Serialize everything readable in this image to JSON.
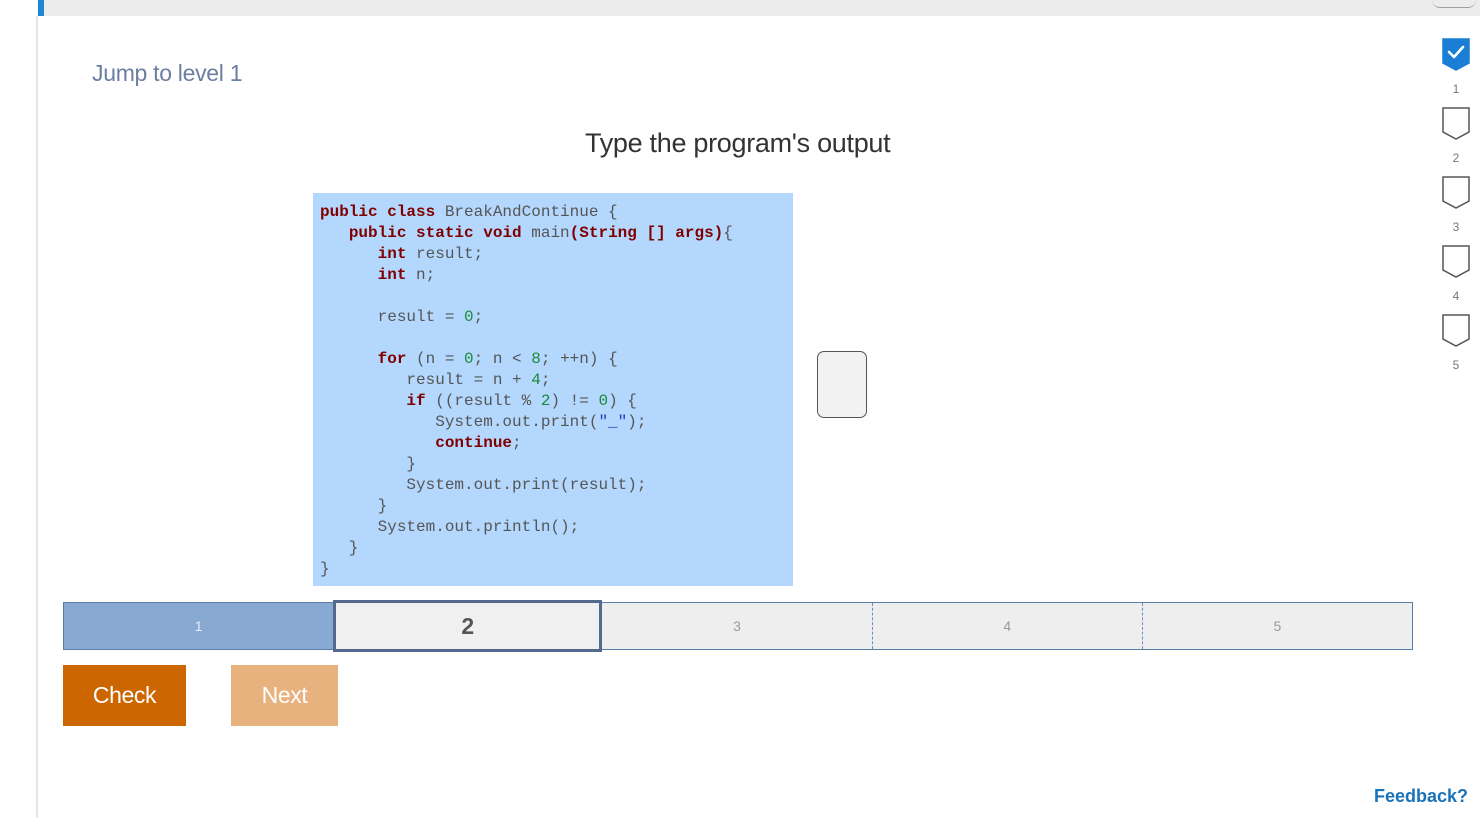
{
  "header": {
    "jump_label": "Jump to level 1"
  },
  "activity": {
    "prompt": "Type the program's output",
    "answer": {
      "value": ""
    }
  },
  "code": {
    "lines": [
      [
        {
          "t": "public class",
          "c": "kw"
        },
        {
          "t": " BreakAndContinue {",
          "c": ""
        }
      ],
      [
        {
          "t": "   ",
          "c": ""
        },
        {
          "t": "public static void",
          "c": "kw"
        },
        {
          "t": " main",
          "c": ""
        },
        {
          "t": "(String [] args)",
          "c": "kw"
        },
        {
          "t": "{",
          "c": ""
        }
      ],
      [
        {
          "t": "      ",
          "c": ""
        },
        {
          "t": "int",
          "c": "kw"
        },
        {
          "t": " result;",
          "c": ""
        }
      ],
      [
        {
          "t": "      ",
          "c": ""
        },
        {
          "t": "int",
          "c": "kw"
        },
        {
          "t": " n;",
          "c": ""
        }
      ],
      [],
      [
        {
          "t": "      result = ",
          "c": ""
        },
        {
          "t": "0",
          "c": "num"
        },
        {
          "t": ";",
          "c": ""
        }
      ],
      [],
      [
        {
          "t": "      ",
          "c": ""
        },
        {
          "t": "for",
          "c": "kw"
        },
        {
          "t": " (n = ",
          "c": ""
        },
        {
          "t": "0",
          "c": "num"
        },
        {
          "t": "; n < ",
          "c": ""
        },
        {
          "t": "8",
          "c": "num"
        },
        {
          "t": "; ++n) {",
          "c": ""
        }
      ],
      [
        {
          "t": "         result = n + ",
          "c": ""
        },
        {
          "t": "4",
          "c": "num"
        },
        {
          "t": ";",
          "c": ""
        }
      ],
      [
        {
          "t": "         ",
          "c": ""
        },
        {
          "t": "if",
          "c": "kw"
        },
        {
          "t": " ((result % ",
          "c": ""
        },
        {
          "t": "2",
          "c": "num"
        },
        {
          "t": ") != ",
          "c": ""
        },
        {
          "t": "0",
          "c": "num"
        },
        {
          "t": ") {",
          "c": ""
        }
      ],
      [
        {
          "t": "            System.out.print(",
          "c": ""
        },
        {
          "t": "\"_\"",
          "c": "str"
        },
        {
          "t": ");",
          "c": ""
        }
      ],
      [
        {
          "t": "            ",
          "c": ""
        },
        {
          "t": "continue",
          "c": "kw"
        },
        {
          "t": ";",
          "c": ""
        }
      ],
      [
        {
          "t": "         }",
          "c": ""
        }
      ],
      [
        {
          "t": "         System.out.print(result);",
          "c": ""
        }
      ],
      [
        {
          "t": "      }",
          "c": ""
        }
      ],
      [
        {
          "t": "      System.out.println();",
          "c": ""
        }
      ],
      [
        {
          "t": "   }",
          "c": ""
        }
      ],
      [
        {
          "t": "}",
          "c": ""
        }
      ]
    ]
  },
  "level_bar": {
    "current": 2,
    "levels": [
      {
        "label": "1",
        "state": "done"
      },
      {
        "label": "2",
        "state": "current"
      },
      {
        "label": "3",
        "state": "todo"
      },
      {
        "label": "4",
        "state": "todo"
      },
      {
        "label": "5",
        "state": "todo"
      }
    ]
  },
  "buttons": {
    "check_label": "Check",
    "next_label": "Next"
  },
  "progress": {
    "steps": [
      {
        "label": "1",
        "completed": true
      },
      {
        "label": "2",
        "completed": false
      },
      {
        "label": "3",
        "completed": false
      },
      {
        "label": "4",
        "completed": false
      },
      {
        "label": "5",
        "completed": false
      }
    ],
    "completed_color": "#1a7fd4",
    "icons": {
      "completed": "check-badge-icon",
      "pending": "empty-badge-icon"
    }
  },
  "footer": {
    "feedback_label": "Feedback?"
  }
}
